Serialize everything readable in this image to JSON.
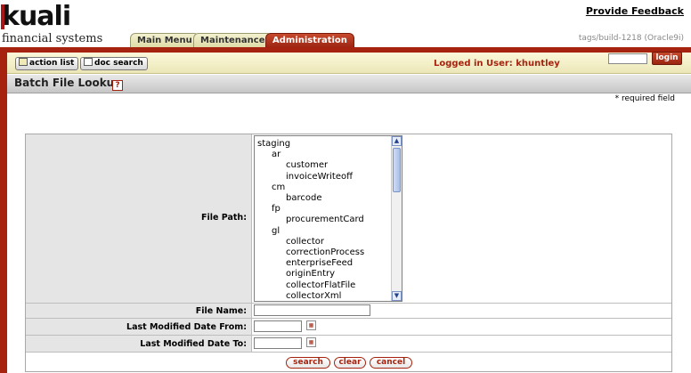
{
  "header": {
    "logo_text": "kuali",
    "logo_subtitle": "financial systems",
    "feedback_link": "Provide Feedback",
    "build_info": "tags/build-1218 (Oracle9i)"
  },
  "tabs": [
    {
      "label": "Main Menu",
      "active": false
    },
    {
      "label": "Maintenance",
      "active": false
    },
    {
      "label": "Administration",
      "active": true
    }
  ],
  "userbar": {
    "action_list_label": "action list",
    "doc_search_label": "doc search",
    "logged_in_text": "Logged in User: khuntley",
    "login_input_value": "",
    "login_button_label": "login"
  },
  "page": {
    "title": "Batch File Lookup",
    "help_icon": "?",
    "required_note": "* required field"
  },
  "form": {
    "file_path_label": "File Path:",
    "file_path_options": [
      {
        "label": "staging",
        "level": 0
      },
      {
        "label": "ar",
        "level": 1
      },
      {
        "label": "customer",
        "level": 2
      },
      {
        "label": "invoiceWriteoff",
        "level": 2
      },
      {
        "label": "cm",
        "level": 1
      },
      {
        "label": "barcode",
        "level": 2
      },
      {
        "label": "fp",
        "level": 1
      },
      {
        "label": "procurementCard",
        "level": 2
      },
      {
        "label": "gl",
        "level": 1
      },
      {
        "label": "collector",
        "level": 2
      },
      {
        "label": "correctionProcess",
        "level": 2
      },
      {
        "label": "enterpriseFeed",
        "level": 2
      },
      {
        "label": "originEntry",
        "level": 2
      },
      {
        "label": "collectorFlatFile",
        "level": 2
      },
      {
        "label": "collectorXml",
        "level": 2
      }
    ],
    "file_name_label": "File Name:",
    "file_name_value": "",
    "date_from_label": "Last Modified Date From:",
    "date_from_value": "",
    "date_to_label": "Last Modified Date To:",
    "date_to_value": ""
  },
  "actions": {
    "search_label": "search",
    "clear_label": "clear",
    "cancel_label": "cancel"
  },
  "colors": {
    "brand_red": "#a6240f",
    "tab_beige": "#ece7b8",
    "label_gray": "#e5e5e5"
  },
  "icons": {
    "help": "help-icon",
    "calendar": "calendar-icon",
    "action_list": "action-list-icon",
    "doc_search": "doc-search-icon"
  }
}
